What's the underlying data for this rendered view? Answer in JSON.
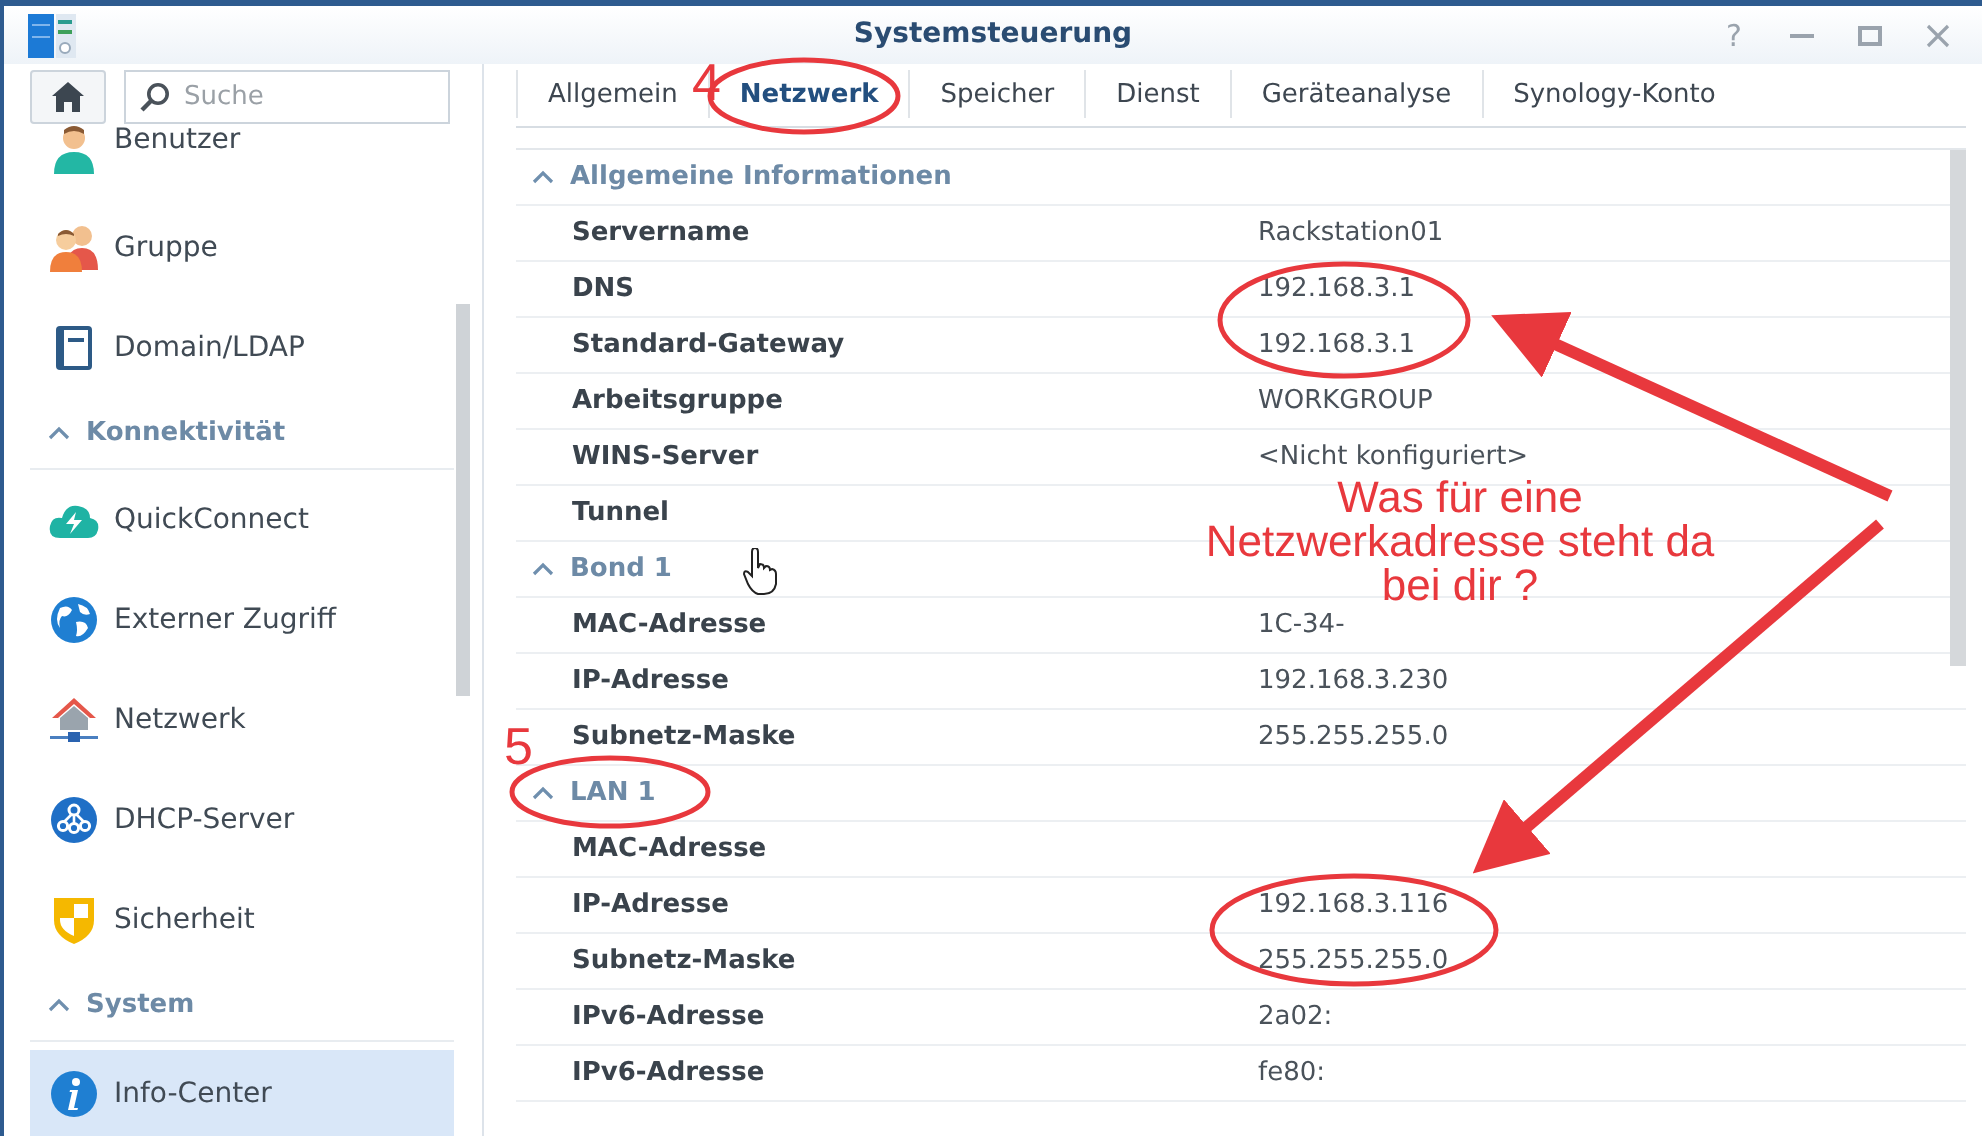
{
  "window": {
    "title": "Systemsteuerung",
    "controls": [
      {
        "kind": "help",
        "label": "?"
      },
      {
        "kind": "minimize"
      },
      {
        "kind": "maximize"
      },
      {
        "kind": "close"
      }
    ]
  },
  "search": {
    "placeholder": "Suche"
  },
  "sidebar": {
    "items": [
      {
        "kind": "user",
        "label": "Benutzer",
        "selected": false
      },
      {
        "kind": "group",
        "label": "Gruppe",
        "selected": false
      },
      {
        "kind": "domain",
        "label": "Domain/LDAP",
        "selected": false
      },
      {
        "kind": "section",
        "label": "Konnektivität",
        "expanded": true
      },
      {
        "kind": "quickconnect",
        "label": "QuickConnect",
        "selected": false
      },
      {
        "kind": "external",
        "label": "Externer Zugriff",
        "selected": false
      },
      {
        "kind": "network",
        "label": "Netzwerk",
        "selected": false
      },
      {
        "kind": "dhcp",
        "label": "DHCP-Server",
        "selected": false
      },
      {
        "kind": "security",
        "label": "Sicherheit",
        "selected": false
      },
      {
        "kind": "section",
        "label": "System",
        "expanded": true
      },
      {
        "kind": "info",
        "label": "Info-Center",
        "selected": true
      }
    ]
  },
  "tabs": [
    {
      "label": "Allgemein",
      "selected": false
    },
    {
      "label": "Netzwerk",
      "selected": true
    },
    {
      "label": "Speicher",
      "selected": false
    },
    {
      "label": "Dienst",
      "selected": false
    },
    {
      "label": "Geräteanalyse",
      "selected": false
    },
    {
      "label": "Synology-Konto",
      "selected": false
    }
  ],
  "details": [
    {
      "title": "Allgemeine Informationen",
      "expanded": true,
      "rows": [
        {
          "label": "Servername",
          "value": "Rackstation01"
        },
        {
          "label": "DNS",
          "value": "192.168.3.1"
        },
        {
          "label": "Standard-Gateway",
          "value": "192.168.3.1"
        },
        {
          "label": "Arbeitsgruppe",
          "value": "WORKGROUP"
        },
        {
          "label": "WINS-Server",
          "value": "<Nicht konfiguriert>"
        },
        {
          "label": "Tunnel"
        }
      ]
    },
    {
      "title": "Bond 1",
      "expanded": true,
      "rows": [
        {
          "label": "MAC-Adresse",
          "value": "1C-34-"
        },
        {
          "label": "IP-Adresse",
          "value": "192.168.3.230"
        },
        {
          "label": "Subnetz-Maske",
          "value": "255.255.255.0"
        }
      ]
    },
    {
      "title": "LAN 1",
      "expanded": true,
      "rows": [
        {
          "label": "MAC-Adresse"
        },
        {
          "label": "IP-Adresse",
          "value": "192.168.3.116"
        },
        {
          "label": "Subnetz-Maske",
          "value": "255.255.255.0"
        },
        {
          "label": "IPv6-Adresse",
          "value": "2a02:"
        },
        {
          "label": "IPv6-Adresse",
          "value": "fe80:"
        }
      ]
    }
  ],
  "annotations": {
    "step_numbers": [
      "4",
      "5"
    ],
    "note": [
      "Was für eine",
      "Netzwerkadresse steht da",
      "bei dir ?"
    ]
  }
}
